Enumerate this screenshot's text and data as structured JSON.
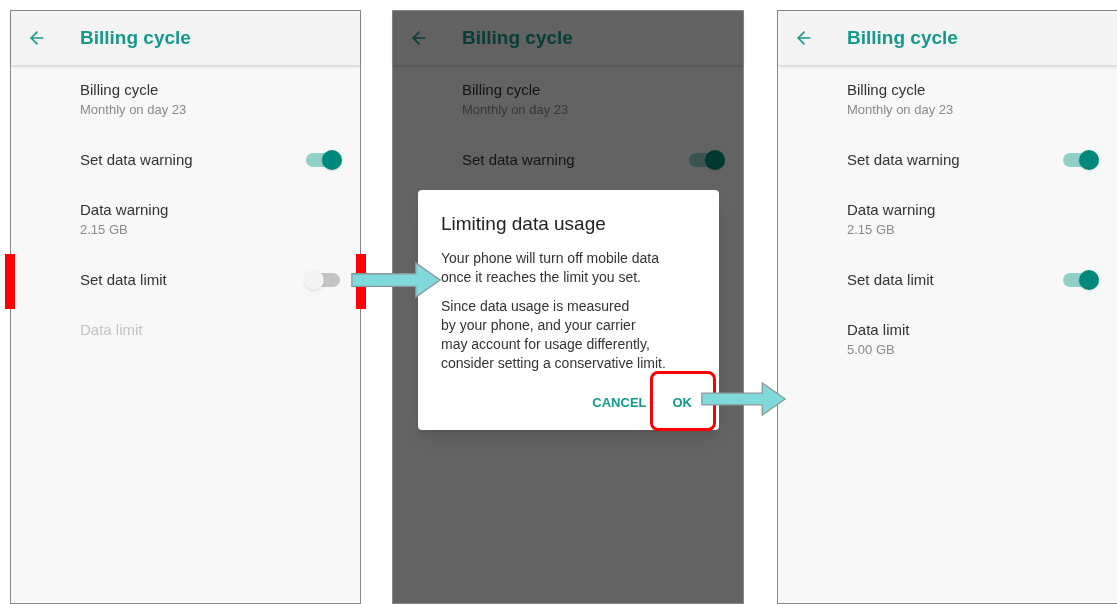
{
  "screens": [
    {
      "title": "Billing cycle",
      "dimmed": false,
      "items": [
        {
          "kind": "text",
          "title": "Billing cycle",
          "summary": "Monthly on day 23",
          "disabled": false,
          "marked": false
        },
        {
          "kind": "switch",
          "title": "Set data warning",
          "on": true,
          "marked": false
        },
        {
          "kind": "text",
          "title": "Data warning",
          "summary": "2.15 GB",
          "disabled": false,
          "marked": false
        },
        {
          "kind": "switch",
          "title": "Set data limit",
          "on": false,
          "marked": true
        },
        {
          "kind": "text",
          "title": "Data limit",
          "disabled": true,
          "marked": false
        }
      ]
    },
    {
      "title": "Billing cycle",
      "dimmed": true,
      "items": [
        {
          "kind": "text",
          "title": "Billing cycle",
          "summary": "Monthly on day 23",
          "disabled": false,
          "marked": false
        },
        {
          "kind": "switch",
          "title": "Set data warning",
          "on": true,
          "marked": false
        }
      ],
      "dialog": {
        "title": "Limiting data usage",
        "paragraphs": [
          "Your phone will turn off mobile data\nonce it reaches the limit you set.",
          "Since data usage is measured\nby your phone, and your carrier\nmay account for usage differently,\nconsider setting a conservative limit."
        ],
        "buttons": [
          {
            "label": "CANCEL",
            "highlighted": false
          },
          {
            "label": "OK",
            "highlighted": true
          }
        ]
      }
    },
    {
      "title": "Billing cycle",
      "dimmed": false,
      "items": [
        {
          "kind": "text",
          "title": "Billing cycle",
          "summary": "Monthly on day 23",
          "disabled": false,
          "marked": false
        },
        {
          "kind": "switch",
          "title": "Set data warning",
          "on": true,
          "marked": false
        },
        {
          "kind": "text",
          "title": "Data warning",
          "summary": "2.15 GB",
          "disabled": false,
          "marked": false
        },
        {
          "kind": "switch",
          "title": "Set data limit",
          "on": true,
          "marked": false
        },
        {
          "kind": "text",
          "title": "Data limit",
          "summary": "5.00 GB",
          "disabled": false,
          "marked": false
        }
      ]
    }
  ]
}
